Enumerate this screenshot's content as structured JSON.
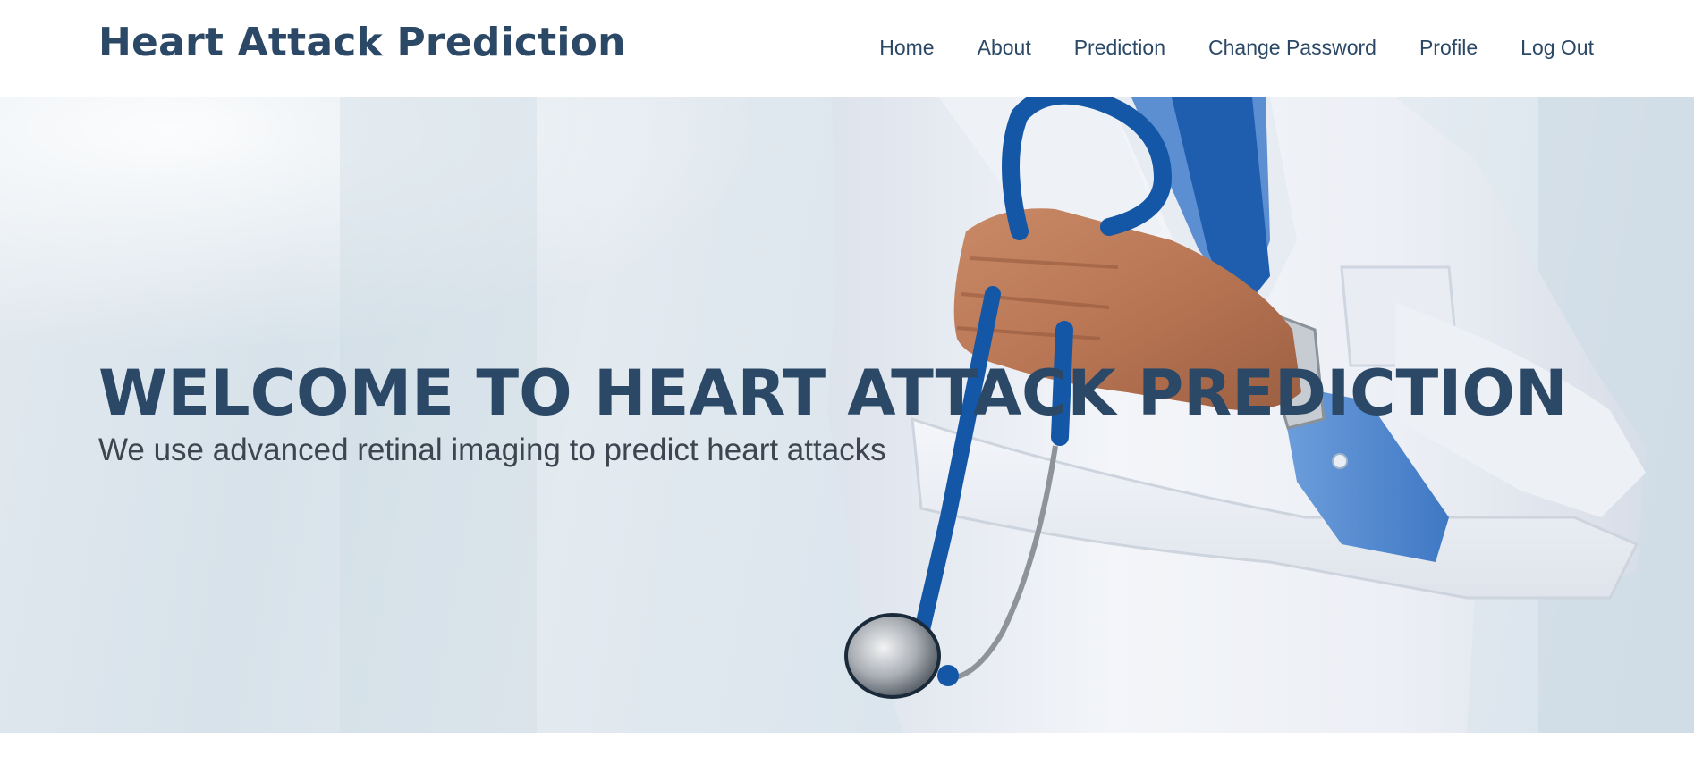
{
  "header": {
    "brand": "Heart Attack Prediction",
    "nav": [
      {
        "label": "Home"
      },
      {
        "label": "About"
      },
      {
        "label": "Prediction"
      },
      {
        "label": "Change Password"
      },
      {
        "label": "Profile"
      },
      {
        "label": "Log Out"
      }
    ]
  },
  "hero": {
    "title": "WELCOME TO HEART ATTACK PREDICTION",
    "subtitle": "We use advanced retinal imaging to predict heart attacks",
    "image": "doctor-with-stethoscope-photo"
  },
  "colors": {
    "brand": "#2b4866",
    "subtitle": "#3d4650",
    "stethoscope": "#1457a6"
  }
}
